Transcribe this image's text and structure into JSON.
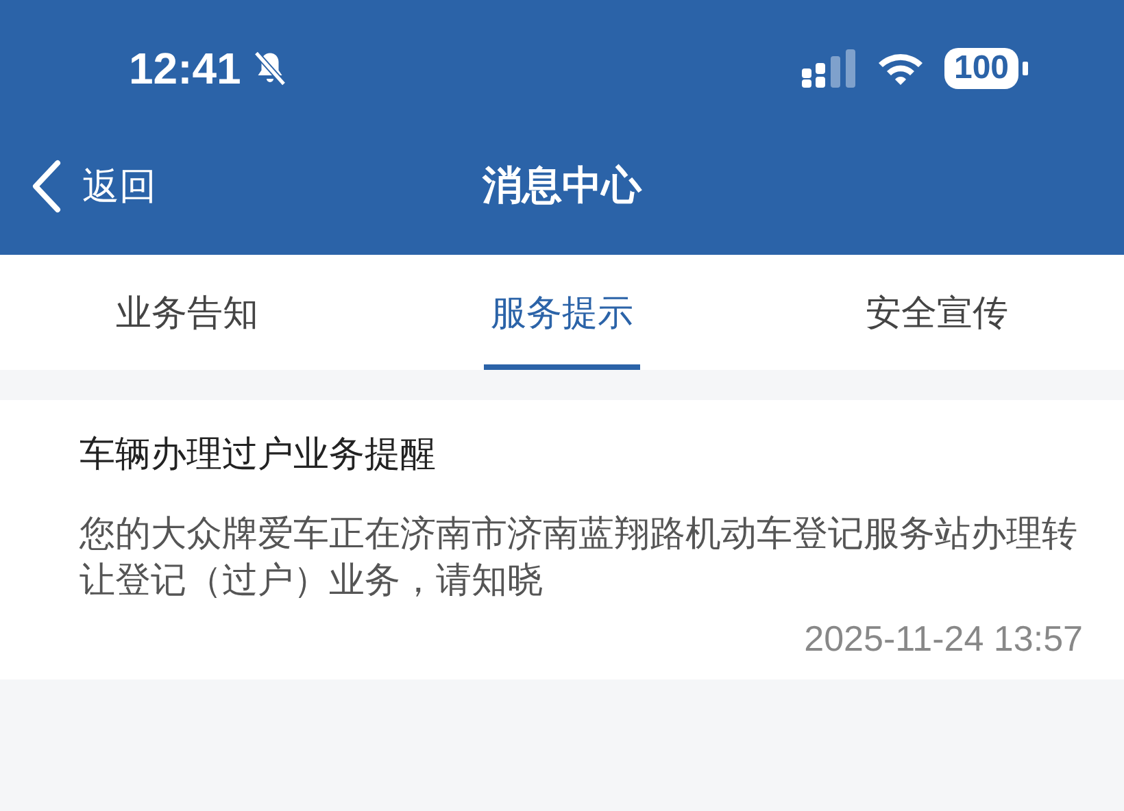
{
  "status_bar": {
    "time": "12:41",
    "muted": true,
    "battery": "100"
  },
  "nav": {
    "back": "返回",
    "title": "消息中心"
  },
  "tabs": [
    {
      "label": "业务告知",
      "selected": false
    },
    {
      "label": "服务提示",
      "selected": true
    },
    {
      "label": "安全宣传",
      "selected": false
    }
  ],
  "messages": [
    {
      "title": "车辆办理过户业务提醒",
      "body": "您的大众牌爱车正在济南市济南蓝翔路机动车登记服务站办理转让登记（过户）业务，请知晓",
      "time": "2025-11-24 13:57"
    }
  ]
}
